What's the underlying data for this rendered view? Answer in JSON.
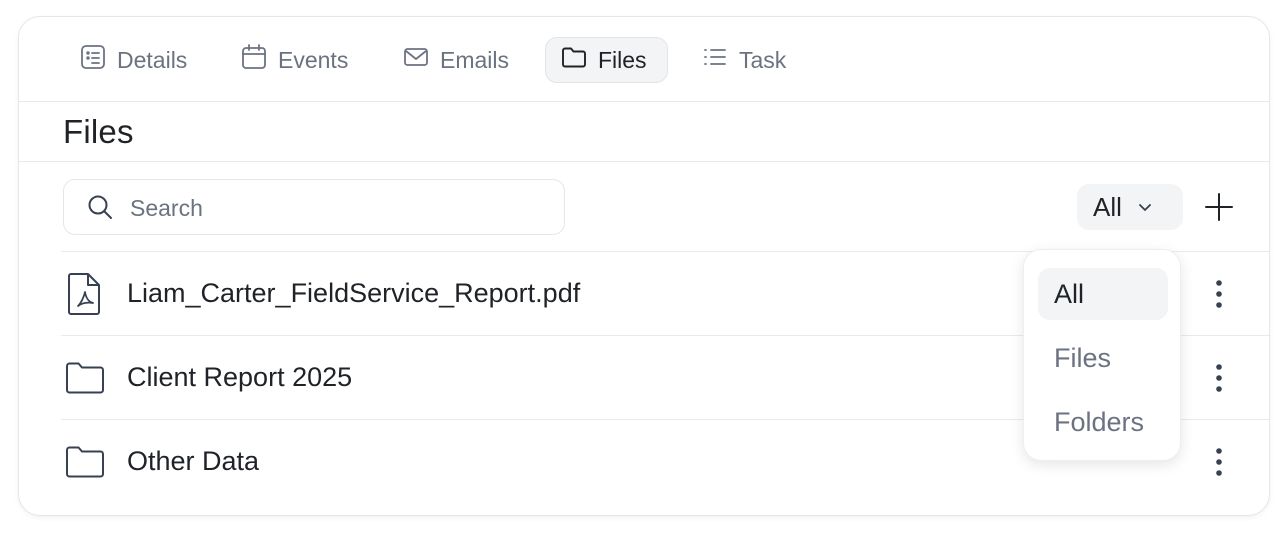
{
  "tabs": [
    {
      "label": "Details",
      "icon": "details-icon"
    },
    {
      "label": "Events",
      "icon": "calendar-icon"
    },
    {
      "label": "Emails",
      "icon": "mail-icon"
    },
    {
      "label": "Files",
      "icon": "folder-icon",
      "active": true
    },
    {
      "label": "Task",
      "icon": "list-icon"
    }
  ],
  "page": {
    "title": "Files"
  },
  "search": {
    "placeholder": "Search",
    "value": ""
  },
  "filter": {
    "selected": "All",
    "options": [
      "All",
      "Files",
      "Folders"
    ]
  },
  "files": [
    {
      "name": "Liam_Carter_FieldService_Report.pdf",
      "type": "pdf"
    },
    {
      "name": "Client Report 2025",
      "type": "folder"
    },
    {
      "name": "Other Data",
      "type": "folder"
    }
  ],
  "colors": {
    "text": "#1f2328",
    "muted": "#6b7280",
    "active_bg": "#f3f4f6",
    "border": "#e4e6ea"
  }
}
